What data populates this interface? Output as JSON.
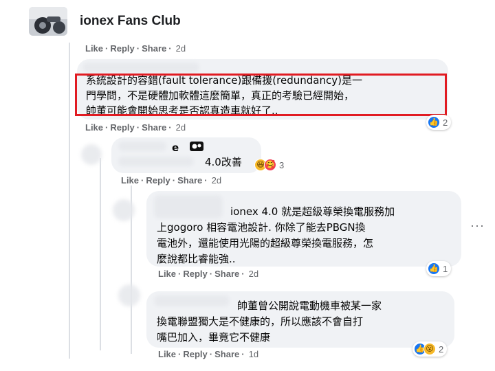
{
  "header": {
    "group_name": "ionex Fans Club"
  },
  "actions": {
    "like": "Like",
    "reply": "Reply",
    "share": "Share",
    "dot": "·"
  },
  "rows": [
    {
      "time": "2d"
    },
    {
      "time": "2d"
    },
    {
      "time": "2d"
    },
    {
      "time": "2d"
    },
    {
      "time": "1d"
    }
  ],
  "comments": [
    {
      "lines": [
        "系統設計的容錯(fault tolerance)跟備援(redundancy)是一",
        "門學問，不是硬體加軟體這麼簡單，真正的考驗已經開始，",
        "帥董可能會開始思考是否認真造車就好了.."
      ],
      "reaction_count": "2"
    },
    {
      "name_tail": "e",
      "text": "4.0改善",
      "reaction_count": "3"
    },
    {
      "lines": [
        "ionex 4.0 就是超級尊榮換電服務加",
        "上gogoro 相容電池設計. 你除了能去PBGN換",
        "電池外，還能使用光陽的超級尊榮換電服務，怎",
        "麼說都比睿能強.."
      ],
      "reaction_count": "1"
    },
    {
      "lines": [
        "帥董曾公開說電動機車被某一家",
        "換電聯盟獨大是不健康的，所以應該不會自打",
        "嘴巴加入，畢竟它不健康"
      ],
      "reaction_count": "2"
    }
  ],
  "icons": {
    "like": "like-icon",
    "haha": "haha-icon",
    "love": "love-icon",
    "wow": "wow-icon",
    "more": "more-options-icon"
  },
  "colors": {
    "highlight": "#e11b22",
    "bubble": "#f0f2f5",
    "meta": "#65676b",
    "like": "#1877f2"
  }
}
